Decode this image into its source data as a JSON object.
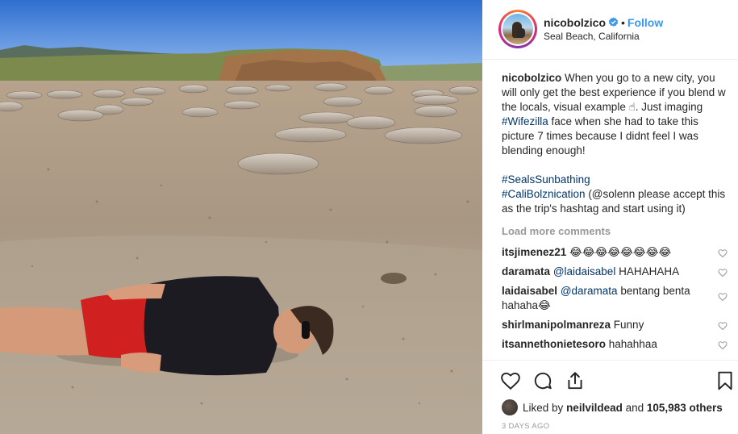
{
  "header": {
    "username": "nicobolzico",
    "follow_label": "Follow",
    "separator": "•",
    "location": "Seal Beach, California",
    "verified_icon": "verified-badge-icon",
    "accent_color": "#3897f0"
  },
  "caption": {
    "username": "nicobolzico",
    "text_before_tag": " When you go to a new city, you will only get the best experience if you blend w the locals, visual example ☝. Just imaging ",
    "tag1": "#Wifezilla",
    "text_after_tag": " face when she had to take this picture 7 times because I didnt feel I was blending enough!",
    "tag2": "#SealsSunbathing",
    "tag3": "#CaliBolznication",
    "text_end": " (@solenn please accept this as the trip's hashtag and start using it)"
  },
  "load_more_label": "Load more comments",
  "comments": [
    {
      "user": "itsjimenez21",
      "text": " 😂😂😂😂😂😂😂😂",
      "mention": ""
    },
    {
      "user": "daramata",
      "mention": "@laidaisabel",
      "text": " HAHAHAHA"
    },
    {
      "user": "laidaisabel",
      "mention": "@daramata",
      "text": " bentang benta hahaha😂"
    },
    {
      "user": "shirlmanipolmanreza",
      "mention": "",
      "text": " Funny"
    },
    {
      "user": "itsannethonietesoro",
      "mention": "",
      "text": " hahahhaa"
    }
  ],
  "likes": {
    "prefix": "Liked by ",
    "user": "neilvildead",
    "middle": " and ",
    "count": "105,983 others"
  },
  "timestamp": "3 DAYS AGO",
  "icons": [
    "heart-icon",
    "comment-icon",
    "share-icon",
    "bookmark-icon"
  ]
}
